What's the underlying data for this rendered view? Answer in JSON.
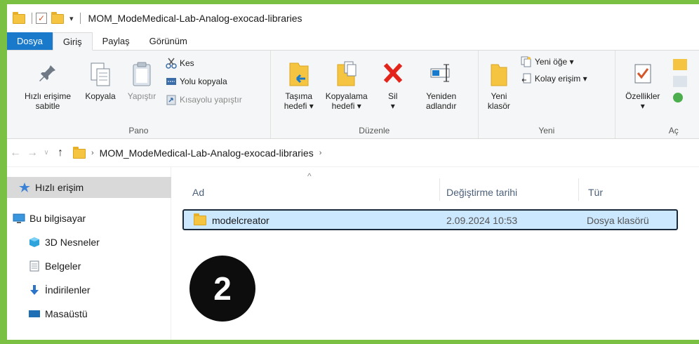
{
  "window": {
    "title": "MOM_ModeMedical-Lab-Analog-exocad-libraries",
    "quick_access_dropdown": "▾"
  },
  "tabs": [
    {
      "label": "Dosya"
    },
    {
      "label": "Giriş"
    },
    {
      "label": "Paylaş"
    },
    {
      "label": "Görünüm"
    }
  ],
  "ribbon": {
    "pano": {
      "label": "Pano",
      "pin": "Hızlı erişime\nsabitle",
      "copy": "Kopyala",
      "paste": "Yapıştır",
      "cut": "Kes",
      "copy_path": "Yolu kopyala",
      "paste_shortcut": "Kısayolu yapıştır"
    },
    "duzenle": {
      "label": "Düzenle",
      "move_to": "Taşıma\nhedefi ▾",
      "copy_to": "Kopyalama\nhedefi ▾",
      "delete": "Sil\n▾",
      "rename": "Yeniden\nadlandır"
    },
    "yeni": {
      "label": "Yeni",
      "new_folder": "Yeni\nklasör",
      "new_item": "Yeni öğe ▾",
      "easy_access": "Kolay erişim ▾"
    },
    "ac": {
      "label": "Aç",
      "properties": "Özellikler\n▾"
    }
  },
  "address": {
    "path_segment": "MOM_ModeMedical-Lab-Analog-exocad-libraries"
  },
  "nav": {
    "items": [
      {
        "label": "Hızlı erişim",
        "icon": "star-icon"
      },
      {
        "label": "Bu bilgisayar",
        "icon": "computer-icon"
      },
      {
        "label": "3D Nesneler",
        "icon": "cube-icon"
      },
      {
        "label": "Belgeler",
        "icon": "document-icon"
      },
      {
        "label": "İndirilenler",
        "icon": "download-icon"
      },
      {
        "label": "Masaüstü",
        "icon": "desktop-icon"
      }
    ]
  },
  "list": {
    "columns": [
      "Ad",
      "Değiştirme tarihi",
      "Tür"
    ],
    "rows": [
      {
        "name": "modelcreator",
        "modified": "2.09.2024 10:53",
        "type": "Dosya klasörü"
      }
    ]
  },
  "annotation": {
    "step_number": "2"
  },
  "colors": {
    "frame_green": "#7ac143",
    "file_tab_blue": "#1979ca",
    "selection_blue": "#cce8ff",
    "folder_yellow": "#f5c542"
  }
}
